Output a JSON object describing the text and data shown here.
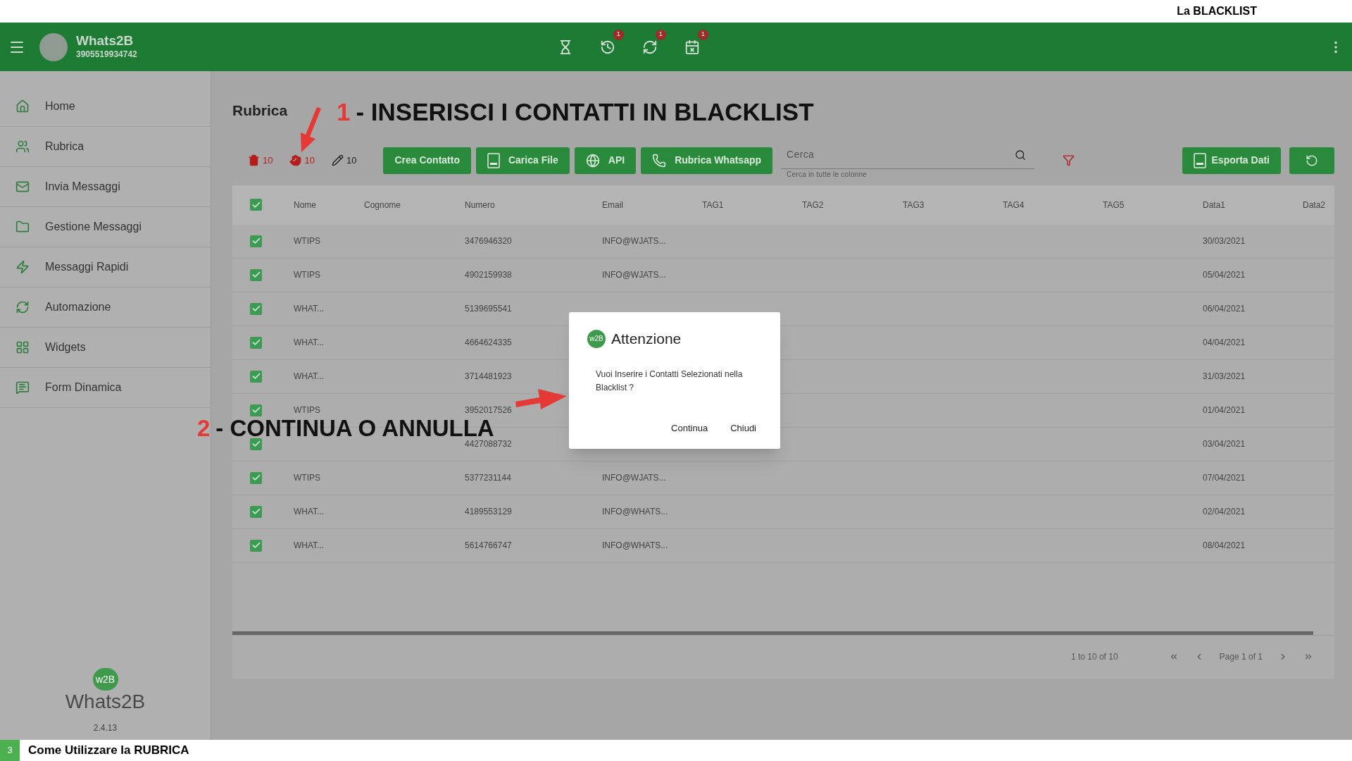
{
  "header_strip": {
    "title": "La BLACKLIST"
  },
  "appbar": {
    "app_name": "Whats2B",
    "phone": "3905519934742",
    "badges": [
      "1",
      "1",
      "1"
    ]
  },
  "sidebar": {
    "items": [
      "Home",
      "Rubrica",
      "Invia Messaggi",
      "Gestione Messaggi",
      "Messaggi Rapidi",
      "Automazione",
      "Widgets",
      "Form Dinamica"
    ],
    "logo": {
      "badge": "w2B",
      "name": "Whats2B"
    },
    "version": "2.4.13"
  },
  "page": {
    "title": "Rubrica",
    "counters": [
      {
        "kind": "delete",
        "count": "10"
      },
      {
        "kind": "blacklist",
        "count": "10"
      },
      {
        "kind": "edit",
        "count": "10"
      }
    ],
    "buttons": [
      "Crea Contatto",
      "Carica File",
      "API",
      "Rubrica Whatsapp"
    ],
    "search": {
      "placeholder": "Cerca",
      "helper": "Cerca in tutte le colonne"
    },
    "export_button": {
      "label": "Esporta Dati"
    }
  },
  "table": {
    "all_checked": true,
    "columns": [
      "Nome",
      "Cognome",
      "Numero",
      "Email",
      "TAG1",
      "TAG2",
      "TAG3",
      "TAG4",
      "TAG5",
      "Data1",
      "Data2"
    ],
    "rows": [
      {
        "checked": true,
        "name": "WTIPS",
        "number": "3476946320",
        "email": "INFO@WJATS...",
        "data1": "30/03/2021"
      },
      {
        "checked": true,
        "name": "WTIPS",
        "number": "4902159938",
        "email": "INFO@WJATS...",
        "data1": "05/04/2021"
      },
      {
        "checked": true,
        "name": "WHAT...",
        "number": "5139695541",
        "data1": "06/04/2021"
      },
      {
        "checked": true,
        "name": "WHAT...",
        "number": "4664624335",
        "data1": "04/04/2021"
      },
      {
        "checked": true,
        "name": "WHAT...",
        "number": "3714481923",
        "data1": "31/03/2021"
      },
      {
        "checked": true,
        "name": "WTIPS",
        "number": "3952017526",
        "data1": "01/04/2021"
      },
      {
        "checked": true,
        "number": "4427088732",
        "data1": "03/04/2021"
      },
      {
        "checked": true,
        "name": "WTIPS",
        "number": "5377231144",
        "email": "INFO@WJATS...",
        "data1": "07/04/2021"
      },
      {
        "checked": true,
        "name": "WHAT...",
        "number": "4189553129",
        "email": "INFO@WHATS...",
        "data1": "02/04/2021"
      },
      {
        "checked": true,
        "name": "WHAT...",
        "number": "5614766747",
        "email": "INFO@WHATS...",
        "data1": "08/04/2021"
      }
    ],
    "range": "1 to 10 of 10",
    "page_label": "Page 1 of 1"
  },
  "dialog": {
    "badge": "w2B",
    "title": "Attenzione",
    "message": "Vuoi Inserire i Contatti Selezionati nella Blacklist ?",
    "buttons": [
      "Continua",
      "Chiudi"
    ]
  },
  "annotations": [
    {
      "number": "1",
      "text": "- INSERISCI I CONTATTI IN BLACKLIST"
    },
    {
      "number": "2",
      "text": "- CONTINUA O ANNULLA"
    }
  ],
  "footer_strip": {
    "step": "3",
    "title": "Come Utilizzare la RUBRICA"
  }
}
